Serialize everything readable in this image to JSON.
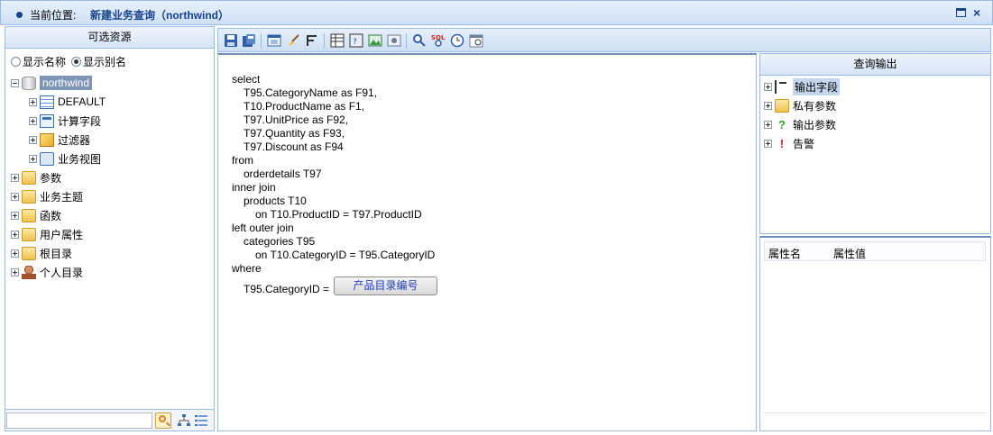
{
  "titlebar": {
    "location_label": "当前位置:",
    "location_value": "新建业务查询（northwind）",
    "close_glyph": "×"
  },
  "left_panel": {
    "title": "可选资源",
    "radio_options": [
      {
        "label": "显示名称",
        "checked": false
      },
      {
        "label": "显示别名",
        "checked": true
      }
    ],
    "tree": [
      {
        "label": "northwind",
        "icon": "database-icon",
        "expanded": true,
        "selected": true
      },
      {
        "label": "DEFAULT",
        "icon": "table-icon"
      },
      {
        "label": "计算字段",
        "icon": "calculated-field-icon"
      },
      {
        "label": "过滤器",
        "icon": "filter-icon"
      },
      {
        "label": "业务视图",
        "icon": "business-view-icon"
      },
      {
        "label": "参数",
        "icon": "parameter-folder-icon"
      },
      {
        "label": "业务主题",
        "icon": "business-topic-folder-icon"
      },
      {
        "label": "函数",
        "icon": "function-folder-icon"
      },
      {
        "label": "用户属性",
        "icon": "user-attribute-folder-icon"
      },
      {
        "label": "根目录",
        "icon": "root-folder-icon"
      },
      {
        "label": "个人目录",
        "icon": "personal-folder-icon"
      }
    ],
    "search_value": ""
  },
  "toolbar": {
    "sql_icon_text": "SQL"
  },
  "sql": {
    "lines": [
      "select",
      "T95.CategoryName as F91,",
      "T10.ProductName as F1,",
      "T97.UnitPrice as F92,",
      "T97.Quantity as F93,",
      "T97.Discount as F94",
      "from",
      "orderdetails T97",
      "inner join",
      "products T10",
      "on T10.ProductID = T97.ProductID",
      "left outer join",
      "categories T95",
      "on T10.CategoryID = T95.CategoryID",
      "where",
      "T95.CategoryID ="
    ],
    "parameter_button": "产品目录编号"
  },
  "output_panel": {
    "title": "查询输出",
    "items": [
      {
        "label": "输出字段",
        "icon": "output-fields-icon",
        "selected": true
      },
      {
        "label": "私有参数",
        "icon": "private-parameter-icon"
      },
      {
        "label": "输出参数",
        "icon": "output-parameter-icon",
        "glyph": "?"
      },
      {
        "label": "告警",
        "icon": "alert-icon",
        "glyph": "!"
      }
    ]
  },
  "properties_panel": {
    "columns": [
      "属性名",
      "属性值"
    ]
  },
  "colors": {
    "border": "#99bbe8",
    "title_text": "#15428b",
    "selection": "#7f95b8",
    "param_text": "#1f3fb6"
  }
}
